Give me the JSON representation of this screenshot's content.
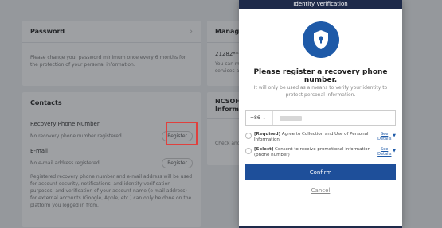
{
  "password": {
    "title": "Password",
    "desc": "Please change your password minimum once every 6 months for the protection of your personal information."
  },
  "manage": {
    "title": "Manage",
    "line1": "21282***",
    "line2": "You can m",
    "line3": "services a"
  },
  "contacts": {
    "title": "Contacts",
    "phone_label": "Recovery Phone Number",
    "phone_status": "No recovery phone number registered.",
    "register_label": "Register",
    "email_label": "E-mail",
    "email_status": "No e-mail address registered.",
    "footer": "Registered recovery phone number and e-mail address will be used for account security, notifications, and identity verification purposes, and verification of your account name (e-mail address) for external accounts (Google, Apple, etc.) can only be done on the platform you logged in from."
  },
  "ncsoft": {
    "title1": "NCSOFT",
    "title2": "Informat",
    "body": "Check and"
  },
  "modal": {
    "header": "Identity Verification",
    "title": "Please register a recovery phone number.",
    "desc": "It will only be used as a means to verify your identity to protect personal information.",
    "country_code": "+86",
    "consent1_tag": "[Required]",
    "consent1_text": " Agree to Collection and Use of Personal Information",
    "consent2_tag": "[Select]",
    "consent2_text": " Consent to receive promotional information (phone number)",
    "see_details": "See Details",
    "confirm": "Confirm",
    "cancel": "Cancel"
  },
  "icons": {
    "shield": "shield-lock-icon",
    "brand_color": "#1e5aa8"
  }
}
